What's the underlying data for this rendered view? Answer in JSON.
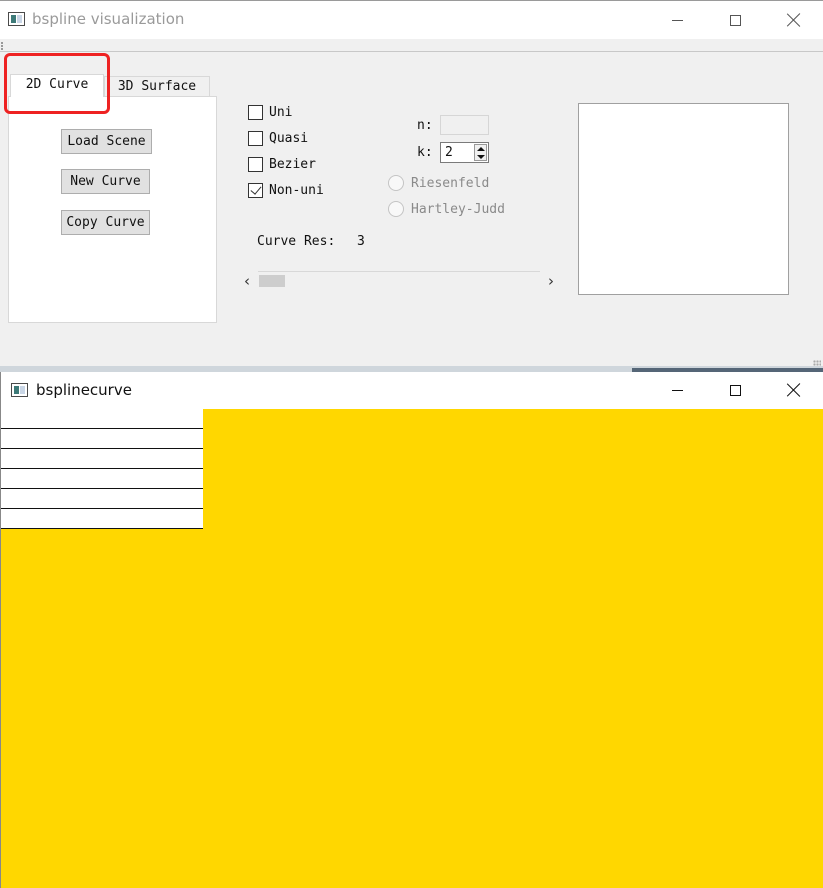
{
  "main_window": {
    "title": "bspline visualization",
    "tabs": [
      {
        "label": "2D Curve",
        "active": true
      },
      {
        "label": "3D Surface",
        "active": false
      }
    ],
    "buttons": {
      "load_scene": "Load Scene",
      "new_curve": "New Curve",
      "copy_curve": "Copy Curve"
    },
    "curve_types": [
      {
        "label": "Uni",
        "checked": false
      },
      {
        "label": "Quasi",
        "checked": false
      },
      {
        "label": "Bezier",
        "checked": false
      },
      {
        "label": "Non-uni",
        "checked": true
      }
    ],
    "n_label": "n:",
    "n_value": "",
    "k_label": "k:",
    "k_value": "2",
    "knot_methods": [
      {
        "label": "Riesenfeld",
        "enabled": false
      },
      {
        "label": "Hartley-Judd",
        "enabled": false
      }
    ],
    "curve_res_label": "Curve Res:",
    "curve_res_value": "3",
    "scrollbar_value_fraction": 0.0
  },
  "curve_window": {
    "title": "bsplinecurve",
    "list_rows": [
      "",
      "",
      "",
      "",
      ""
    ],
    "canvas_color": "#ffd700"
  },
  "colors": {
    "highlight": "#ee2222",
    "canvas": "#ffd700"
  }
}
